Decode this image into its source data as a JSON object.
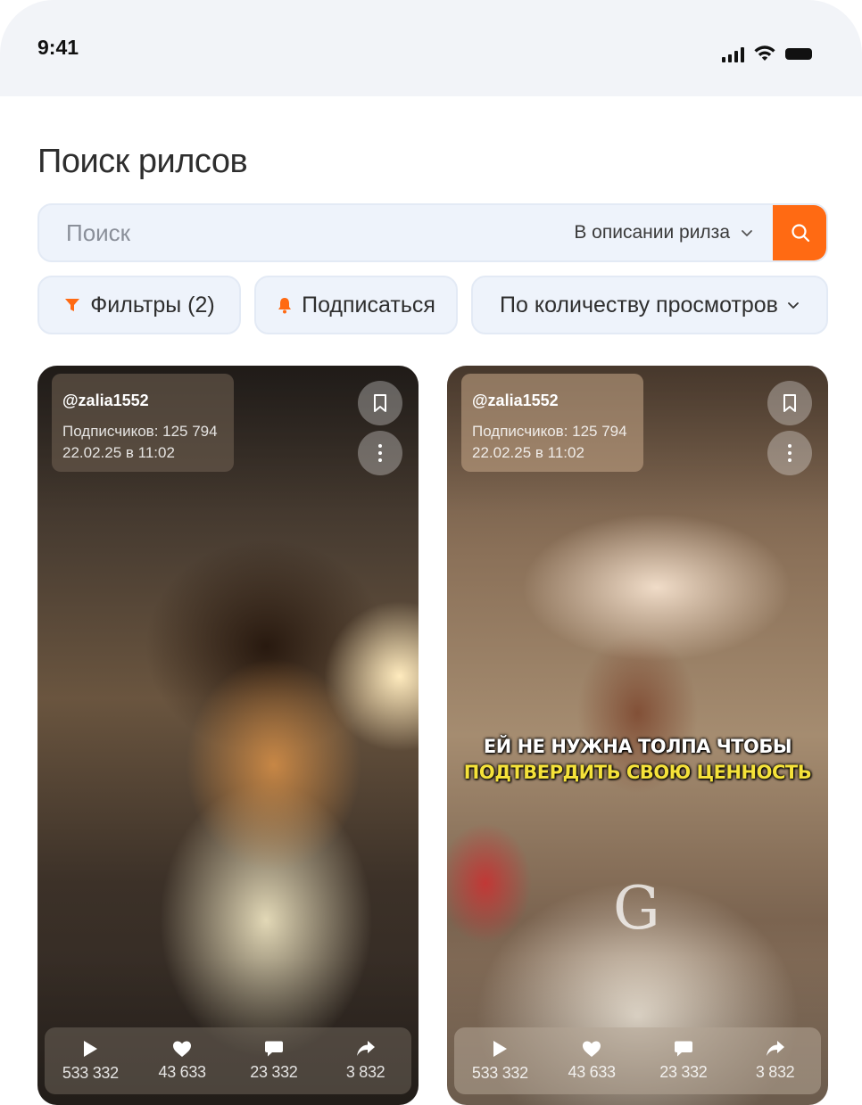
{
  "status_bar": {
    "time": "9:41"
  },
  "page_title": "Поиск рилсов",
  "search": {
    "placeholder": "Поиск",
    "scope_label": "В описании риlза",
    "scope_label_display": "В описании риlза"
  },
  "chips": {
    "filters": "Фильтры (2)",
    "subscribe": "Подписаться",
    "sort": "По количеству просмотров"
  },
  "colors": {
    "accent": "#ff6a13",
    "surface": "#eef3fb",
    "status_bar_bg": "#f2f4f8",
    "caption_yellow": "#f5e23a"
  },
  "cards": [
    {
      "username": "@zalia1552",
      "subscribers": "Подписчиков: 125 794",
      "date": "22.02.25 в 11:02",
      "stats": {
        "views": "533 332",
        "likes": "43 633",
        "comments": "23 332",
        "shares": "3 832"
      }
    },
    {
      "username": "@zalia1552",
      "subscribers": "Подписчиков: 125 794",
      "date": "22.02.25 в 11:02",
      "caption_line1": "ЕЙ НЕ НУЖНА ТОЛПА ЧТОБЫ",
      "caption_line2": "ПОДТВЕРДИТЬ СВОЮ ЦЕННОСТЬ",
      "watermark": "G",
      "stats": {
        "views": "533 332",
        "likes": "43 633",
        "comments": "23 332",
        "shares": "3 832"
      }
    }
  ],
  "icons": {
    "search": "search-icon",
    "filter": "filter-icon",
    "bell": "bell-icon",
    "chevron": "chevron-down-icon",
    "bookmark": "bookmark-icon",
    "more": "more-vertical-icon",
    "play": "play-icon",
    "heart": "heart-icon",
    "comment": "comment-icon",
    "share": "share-icon"
  }
}
